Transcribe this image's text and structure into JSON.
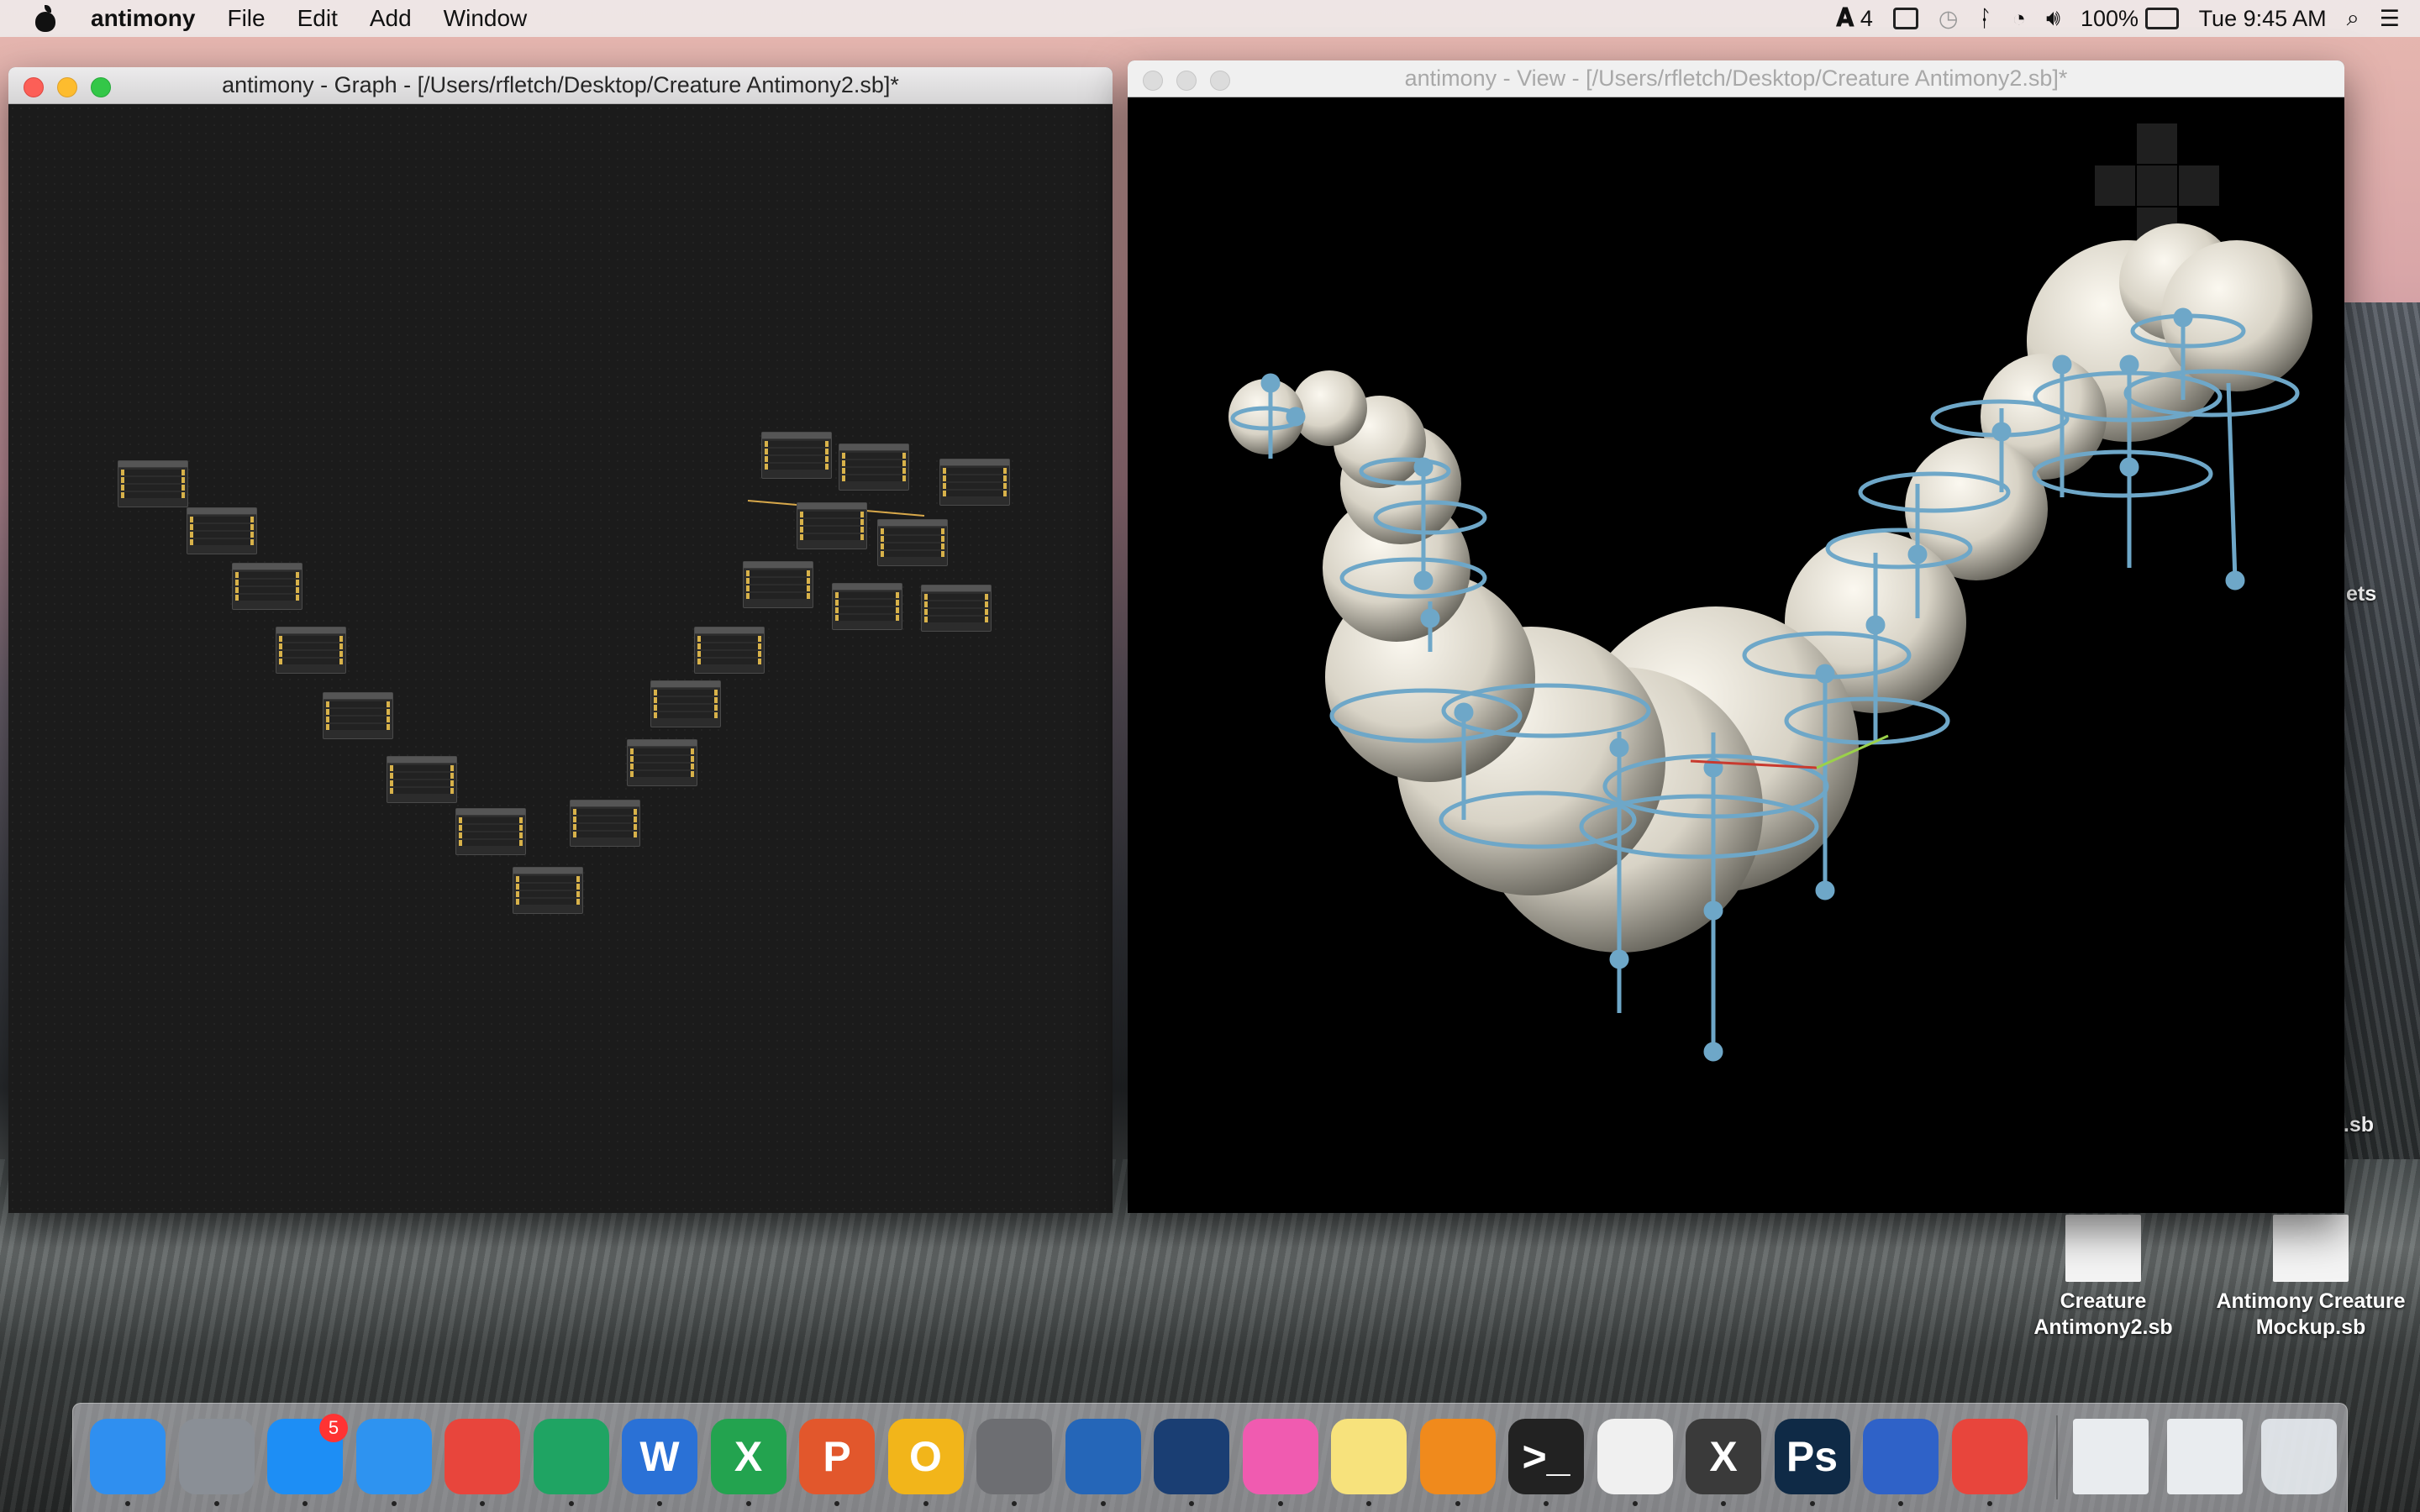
{
  "menubar": {
    "app_name": "antimony",
    "menus": [
      "File",
      "Edit",
      "Add",
      "Window"
    ],
    "status": {
      "adobe_count": "4",
      "battery": "100%",
      "clock": "Tue 9:45 AM"
    }
  },
  "graph_window": {
    "title": "antimony - Graph - [/Users/rfletch/Desktop/Creature Antimony2.sb]*"
  },
  "view_window": {
    "title": "antimony - View - [/Users/rfletch/Desktop/Creature Antimony2.sb]*"
  },
  "desktop": {
    "files": [
      {
        "label": "Creature Antimony2.sb"
      },
      {
        "label": "Antimony Creature Mockup.sb"
      }
    ],
    "partial_labels": [
      "ets",
      "ure.sb"
    ]
  },
  "dock": {
    "apps": [
      {
        "name": "Finder",
        "icon": "finder-icon",
        "color": "#2f8ff0"
      },
      {
        "name": "Launchpad",
        "icon": "rocket-icon",
        "color": "#8a8f96"
      },
      {
        "name": "App Store",
        "icon": "app-store-icon",
        "color": "#1d8ef5",
        "badge": "5"
      },
      {
        "name": "Safari",
        "icon": "compass-icon",
        "color": "#2e93f0"
      },
      {
        "name": "Chrome",
        "icon": "chrome-icon",
        "color": "#e8453c"
      },
      {
        "name": "Google Drive",
        "icon": "drive-icon",
        "color": "#1fa463"
      },
      {
        "name": "Word",
        "icon": "word-icon",
        "color": "#2a71d6",
        "glyph": "W"
      },
      {
        "name": "Excel",
        "icon": "excel-icon",
        "color": "#23a34f",
        "glyph": "X"
      },
      {
        "name": "PowerPoint",
        "icon": "powerpoint-icon",
        "color": "#e2572c",
        "glyph": "P"
      },
      {
        "name": "Outlook",
        "icon": "outlook-icon",
        "color": "#f2b51a",
        "glyph": "O"
      },
      {
        "name": "System Preferences",
        "icon": "gear-icon",
        "color": "#6d6e72"
      },
      {
        "name": "Toggl",
        "icon": "square-icon",
        "color": "#2566b8"
      },
      {
        "name": "Battle.net",
        "icon": "battlenet-icon",
        "color": "#1a3e73"
      },
      {
        "name": "iTunes",
        "icon": "music-note-icon",
        "color": "#f05bb0"
      },
      {
        "name": "Notes",
        "icon": "notes-icon",
        "color": "#f7e27c"
      },
      {
        "name": "iBooks",
        "icon": "book-icon",
        "color": "#f08a1c"
      },
      {
        "name": "Terminal",
        "icon": "terminal-icon",
        "color": "#222222",
        "glyph": ">_"
      },
      {
        "name": "Photos",
        "icon": "photos-icon",
        "color": "#f0f0f0"
      },
      {
        "name": "X11",
        "icon": "x-icon",
        "color": "#3a3a3a",
        "glyph": "X"
      },
      {
        "name": "Photoshop",
        "icon": "photoshop-icon",
        "color": "#0f2a46",
        "glyph": "Ps"
      },
      {
        "name": "Antimony",
        "icon": "antimony-icon",
        "color": "#2f62c8"
      },
      {
        "name": "Chrome",
        "icon": "chrome-icon",
        "color": "#e8453c"
      }
    ],
    "trailing": [
      {
        "name": "Screenshot 1",
        "icon": "document-icon"
      },
      {
        "name": "Screenshot 2",
        "icon": "document-icon"
      },
      {
        "name": "Trash",
        "icon": "trash-icon"
      }
    ]
  }
}
